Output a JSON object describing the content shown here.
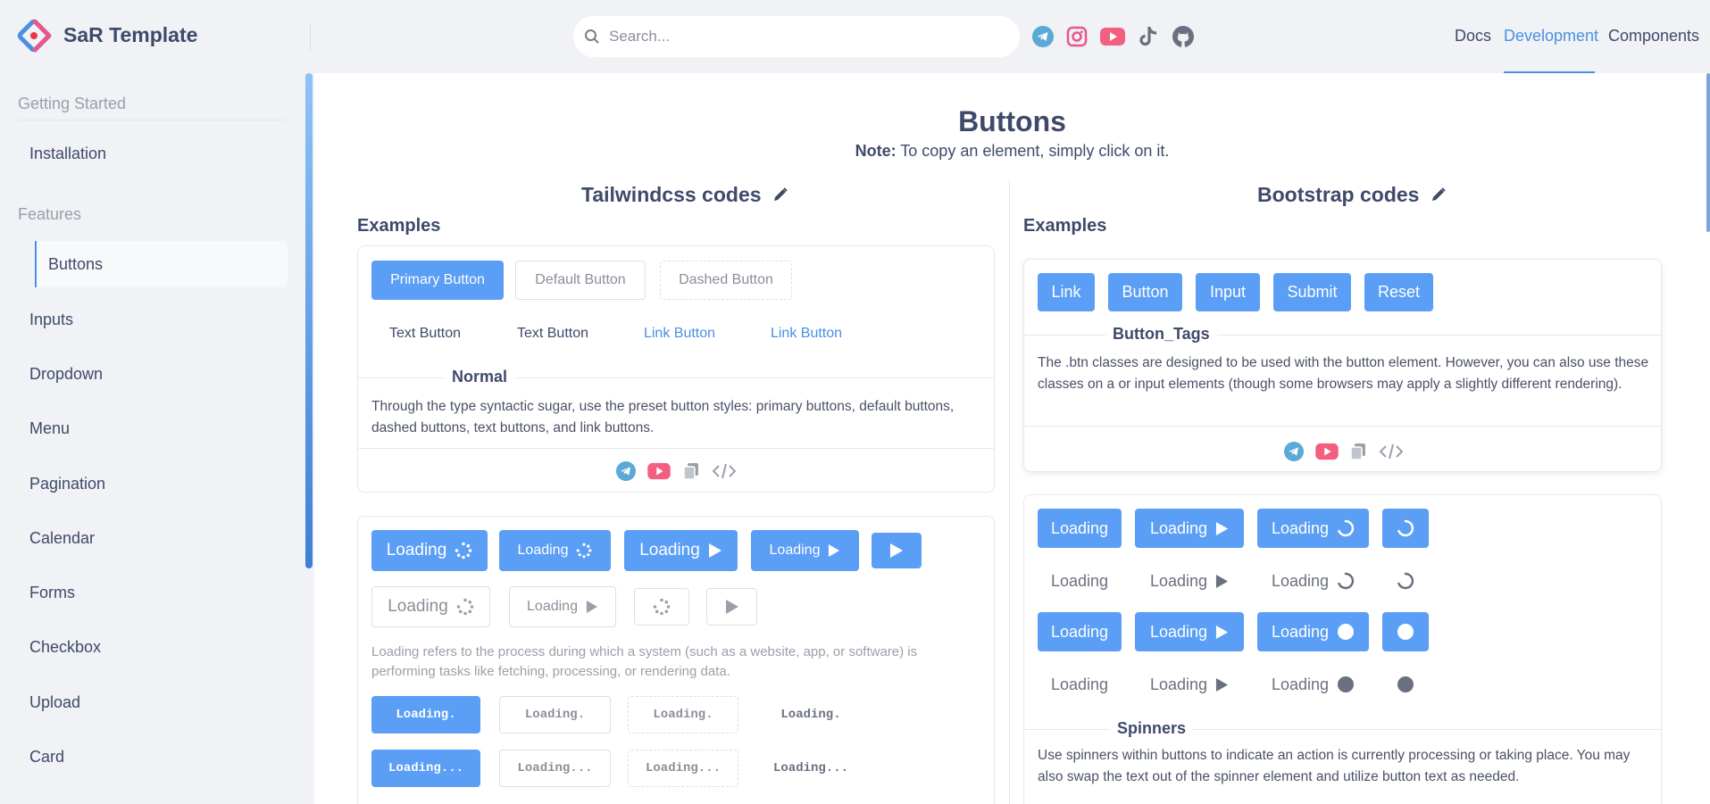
{
  "app": {
    "brand": "SaR Template"
  },
  "search": {
    "placeholder": "Search..."
  },
  "topnav": {
    "docs": "Docs",
    "development": "Development",
    "components": "Components"
  },
  "sidebar": {
    "sections": [
      "Getting Started",
      "Features"
    ],
    "items": [
      "Installation",
      "Buttons",
      "Inputs",
      "Dropdown",
      "Menu",
      "Pagination",
      "Calendar",
      "Forms",
      "Checkbox",
      "Upload",
      "Card"
    ]
  },
  "page": {
    "title": "Buttons",
    "note_label": "Note:",
    "note_text": "To copy an element, simply click on it."
  },
  "tailwind": {
    "heading": "Tailwindcss codes",
    "examples": "Examples",
    "card1": {
      "buttons": [
        "Primary Button",
        "Default Button",
        "Dashed Button",
        "Text Button",
        "Text Button",
        "Link Button",
        "Link Button"
      ],
      "divider": "Normal",
      "description": "Through the type syntactic sugar, use the preset button styles: primary buttons, default buttons, dashed buttons, text buttons, and link buttons."
    },
    "card2": {
      "loading_label": "Loading",
      "description": "Loading refers to the process during which a system (such as a website, app, or software) is performing tasks like fetching, processing, or rendering data.",
      "dots1": "Loading.",
      "dots3": "Loading..."
    }
  },
  "bootstrap": {
    "heading": "Bootstrap codes",
    "examples": "Examples",
    "card1": {
      "buttons": [
        "Link",
        "Button",
        "Input",
        "Submit",
        "Reset"
      ],
      "divider": "Button_Tags",
      "description": "The .btn classes are designed to be used with the button element. However, you can also use these classes on a or input elements (though some browsers may apply a slightly different rendering)."
    },
    "card2": {
      "loading_label": "Loading",
      "divider": "Spinners",
      "description": "Use spinners within buttons to indicate an action is currently processing or taking place. You may also swap the text out of the spinner element and utilize button text as needed."
    }
  },
  "colors": {
    "accent": "#4a90e2",
    "primary_button": "#5b9ef5",
    "telegram": "#5aa9d6",
    "youtube": "#f25f7f",
    "instagram": "#e8578a"
  },
  "icons": [
    "search-icon",
    "telegram-icon",
    "instagram-icon",
    "youtube-icon",
    "tiktok-icon",
    "github-icon",
    "pencil-icon",
    "copy-icon",
    "code-icon",
    "spinner-icon",
    "play-icon"
  ]
}
